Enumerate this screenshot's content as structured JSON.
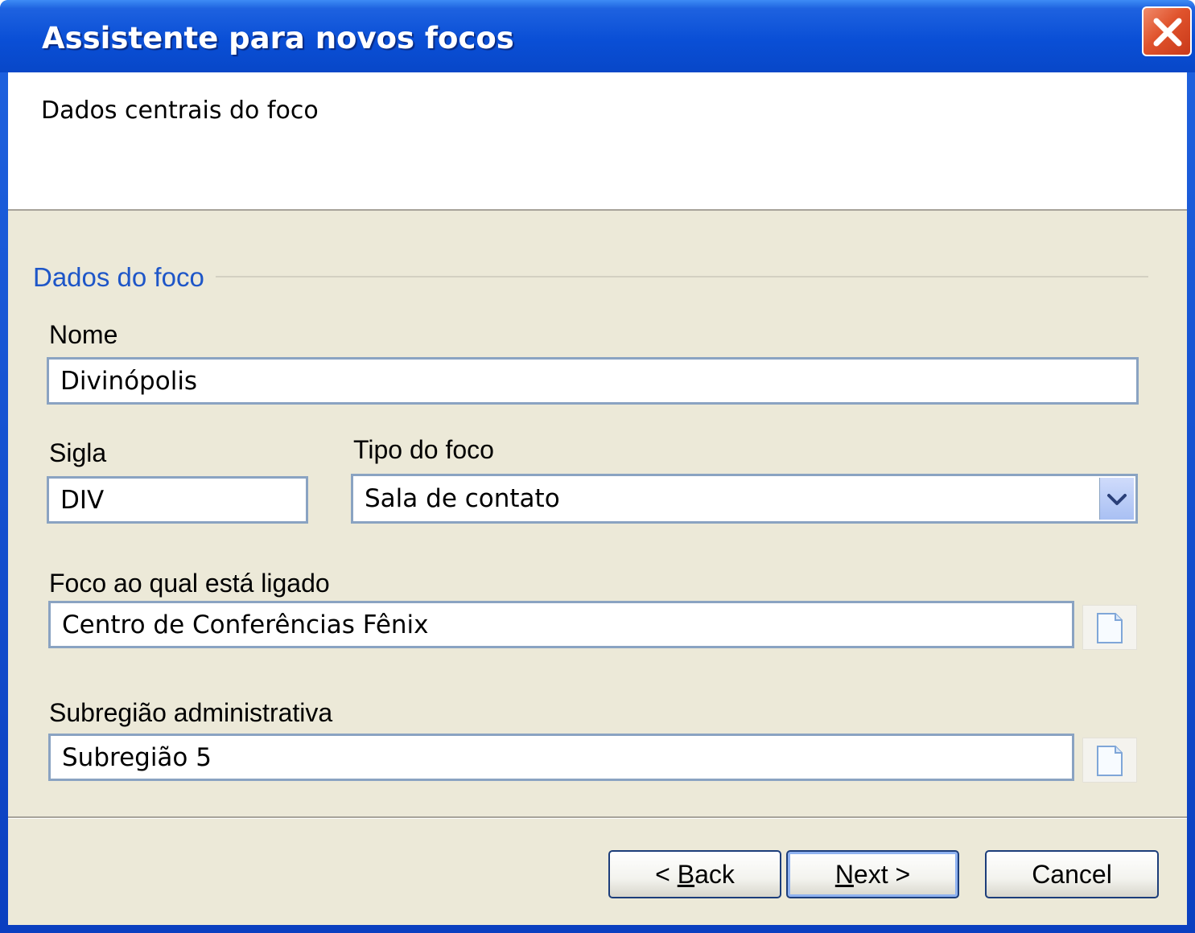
{
  "window": {
    "title": "Assistente para novos focos"
  },
  "header": {
    "subtitle": "Dados centrais do foco"
  },
  "section": {
    "title": "Dados do foco"
  },
  "fields": {
    "nome": {
      "label": "Nome",
      "value": "Divinópolis"
    },
    "sigla": {
      "label": "Sigla",
      "value": "DIV"
    },
    "tipo": {
      "label": "Tipo do foco",
      "value": "Sala de contato"
    },
    "foco_ligado": {
      "label": "Foco ao qual está ligado",
      "value": "Centro de Conferências Fênix"
    },
    "subregiao": {
      "label": "Subregião administrativa",
      "value": "Subregião 5"
    }
  },
  "buttons": {
    "back": {
      "prefix": "< ",
      "mnemonic": "B",
      "rest": "ack"
    },
    "next": {
      "mnemonic": "N",
      "rest": "ext >"
    },
    "cancel": "Cancel"
  },
  "icons": {
    "close": "close-icon",
    "dropdown": "chevron-down-icon",
    "browse": "document-icon"
  },
  "colors": {
    "titlebar": "#0a4fd6",
    "section_title": "#1e56c8",
    "field_border": "#8aa3c2",
    "client_bg": "#ece9d8",
    "close_button": "#e0532c"
  }
}
